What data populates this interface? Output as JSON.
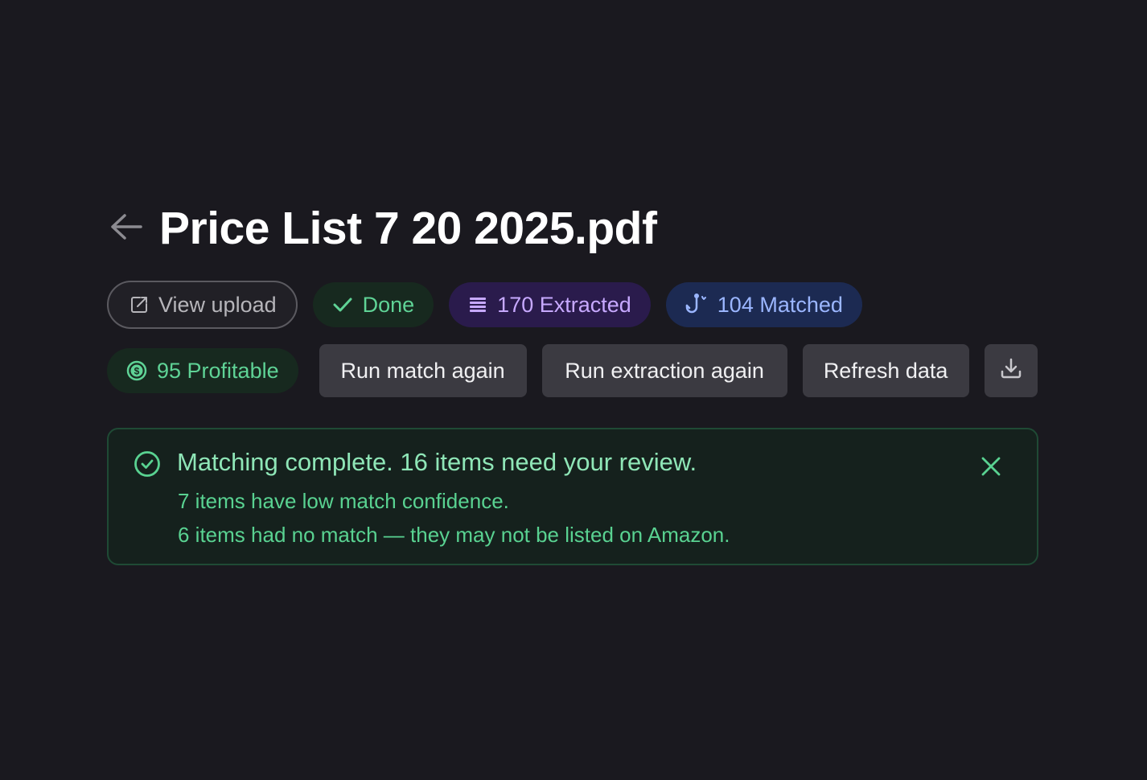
{
  "header": {
    "title": "Price List 7 20 2025.pdf",
    "back_icon": "arrow-left-icon"
  },
  "status_pills": {
    "view_upload": {
      "label": "View upload",
      "icon": "external-link-icon"
    },
    "done": {
      "label": "Done",
      "icon": "check-icon"
    },
    "extracted": {
      "label": "170 Extracted",
      "icon": "list-icon"
    },
    "matched": {
      "label": "104 Matched",
      "icon": "hook-icon"
    },
    "profitable": {
      "label": "95 Profitable",
      "icon": "dollar-circle-icon"
    }
  },
  "actions": {
    "run_match_again": "Run match again",
    "run_extraction_again": "Run extraction again",
    "refresh_data": "Refresh data",
    "download_icon": "download-icon"
  },
  "alert": {
    "title": "Matching complete. 16 items need your review.",
    "lines": [
      "7 items have low match confidence.",
      "6 items had no match — they may not be listed on Amazon."
    ],
    "icon": "check-circle-icon",
    "close_icon": "close-icon"
  },
  "colors": {
    "background": "#1a191f",
    "success": "#5fd396",
    "extracted": "#c7a9ff",
    "matched": "#9bb6ff",
    "button": "#3b3a41"
  }
}
